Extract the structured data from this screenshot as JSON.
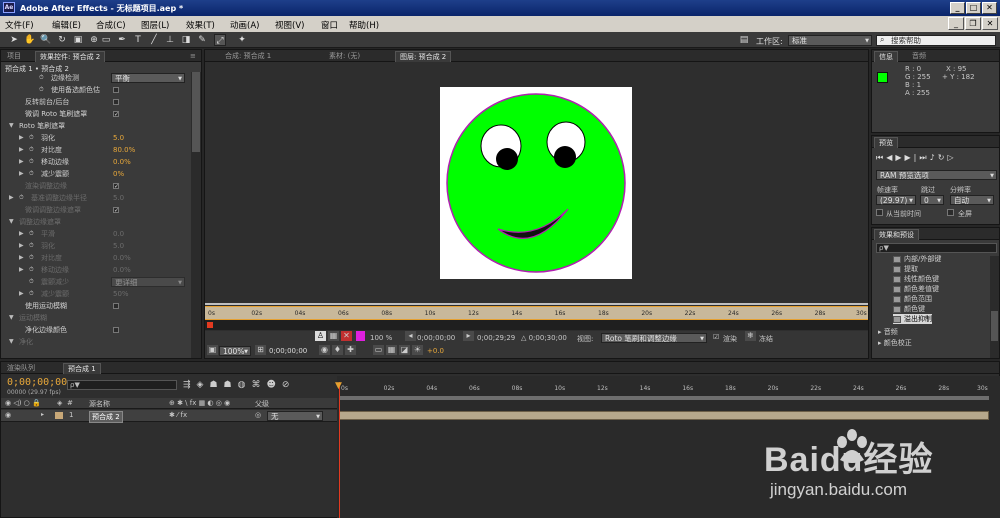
{
  "app": {
    "title": "Adobe After Effects - 无标题项目.aep *",
    "logo": "Ae"
  },
  "menu": [
    "文件(F)",
    "编辑(E)",
    "合成(C)",
    "图层(L)",
    "效果(T)",
    "动画(A)",
    "视图(V)",
    "窗口",
    "帮助(H)"
  ],
  "toolbar": {
    "workspace_label": "工作区:",
    "workspace_value": "标准",
    "search_placeholder": "搜索帮助"
  },
  "left_panel": {
    "tabs": [
      "项目",
      "效果控件: 预合成 2",
      "≡"
    ],
    "breadcrumb": "预合成 1 • 预合成 2",
    "rows": [
      {
        "label": "边缘检测",
        "value": "平衡",
        "type": "dropdown",
        "dim": false,
        "indent": 3
      },
      {
        "label": "使用备选颜色估",
        "value": "",
        "type": "check",
        "checked": false,
        "dim": false,
        "indent": 3
      },
      {
        "label": "反转前台/后台",
        "value": "",
        "type": "check",
        "checked": false,
        "dim": false,
        "indent": 1
      },
      {
        "label": "微调 Roto 笔刷遮罩",
        "value": "",
        "type": "check",
        "checked": true,
        "dim": false,
        "indent": 1
      },
      {
        "label": "Roto 笔刷遮罩",
        "value": "",
        "type": "group",
        "dim": false,
        "indent": 1
      },
      {
        "label": "羽化",
        "value": "5.0",
        "type": "num",
        "dim": false,
        "indent": 2
      },
      {
        "label": "对比度",
        "value": "80.0%",
        "type": "num",
        "dim": false,
        "indent": 2
      },
      {
        "label": "移动边缘",
        "value": "0.0%",
        "type": "num",
        "dim": false,
        "indent": 2
      },
      {
        "label": "减少震颤",
        "value": "0%",
        "type": "num",
        "dim": false,
        "indent": 2
      },
      {
        "label": "渲染调整边缘",
        "value": "",
        "type": "check",
        "checked": true,
        "dim": true,
        "indent": 1
      },
      {
        "label": "基准调整边缘半径",
        "value": "5.0",
        "type": "num",
        "dim": true,
        "indent": 1
      },
      {
        "label": "微调调整边缘遮罩",
        "value": "",
        "type": "check",
        "checked": true,
        "dim": true,
        "indent": 1
      },
      {
        "label": "调整边缘遮罩",
        "value": "",
        "type": "group",
        "dim": true,
        "indent": 1
      },
      {
        "label": "平滑",
        "value": "0.0",
        "type": "num",
        "dim": true,
        "indent": 2
      },
      {
        "label": "羽化",
        "value": "5.0",
        "type": "num",
        "dim": true,
        "indent": 2
      },
      {
        "label": "对比度",
        "value": "0.0%",
        "type": "num",
        "dim": true,
        "indent": 2
      },
      {
        "label": "移动边缘",
        "value": "0.0%",
        "type": "num",
        "dim": true,
        "indent": 2
      },
      {
        "label": "震颤减少",
        "value": "更详细",
        "type": "dropdown",
        "dim": true,
        "indent": 2
      },
      {
        "label": "减少震颤",
        "value": "50%",
        "type": "num",
        "dim": true,
        "indent": 2
      },
      {
        "label": "使用运动模糊",
        "value": "",
        "type": "check",
        "checked": false,
        "dim": false,
        "indent": 1
      },
      {
        "label": "运动模糊",
        "value": "",
        "type": "group",
        "dim": true,
        "indent": 1
      },
      {
        "label": "净化边缘颜色",
        "value": "",
        "type": "check",
        "checked": false,
        "dim": false,
        "indent": 1
      },
      {
        "label": "净化",
        "value": "",
        "type": "group",
        "dim": true,
        "indent": 1
      }
    ]
  },
  "viewer": {
    "tabs": [
      "合成: 预合成 1",
      "素材: (无)",
      "图层: 预合成 2"
    ],
    "ruler_labels": [
      "0s",
      "02s",
      "04s",
      "06s",
      "08s",
      "10s",
      "12s",
      "14s",
      "16s",
      "18s",
      "20s",
      "22s",
      "24s",
      "26s",
      "28s",
      "30s"
    ],
    "times": {
      "start": "0;00;00;00",
      "end": "0;00;29;29",
      "duration": "△ 0;00;30;00"
    },
    "view_label": "视图:",
    "view_value": "Roto 笔刷和调整边缘",
    "render_label": "渲染",
    "freeze_label": "冻结",
    "zoom": "100%",
    "zoom_pct": "100 %",
    "exposure": "+0.0",
    "current_time": "0;00;00;00",
    "colors": {
      "face": "#00ff00",
      "outline": "#b020b0",
      "bg": "#ffffff"
    }
  },
  "info_panel": {
    "tabs": [
      "信息",
      "音频"
    ],
    "r": "R : 0",
    "g": "G : 255",
    "b": "B : 1",
    "a": "A : 255",
    "x": "X : 95",
    "y": "+ Y : 182",
    "swatch": "#00ff00"
  },
  "preview_panel": {
    "tab": "预览",
    "ram_label": "RAM 预览选项",
    "frame_rate_label": "帧速率",
    "skip_label": "跳过",
    "resolution_label": "分辨率",
    "frame_rate": "(29.97)",
    "skip": "0",
    "resolution": "自动",
    "from_current": "从当前时间",
    "fullscreen": "全屏"
  },
  "effects_panel": {
    "tab": "效果和预设",
    "search_placeholder": "ρ▼",
    "items": [
      "内部/外部键",
      "提取",
      "线性颜色键",
      "颜色差值键",
      "颜色范围",
      "颜色键",
      "溢出抑制"
    ],
    "groups": [
      "音频",
      "颜色校正"
    ]
  },
  "timeline": {
    "tabs": [
      "渲染队列",
      "预合成 1"
    ],
    "current_time": "0;00;00;00",
    "fps": "00000 (29.97 fps)",
    "search_placeholder": "ρ▼",
    "col_source": "源名称",
    "col_parent": "父级",
    "layer_index": "1",
    "layer_name": "预合成 2",
    "parent_value": "无",
    "ruler_labels": [
      "0s",
      "02s",
      "04s",
      "06s",
      "08s",
      "10s",
      "12s",
      "14s",
      "16s",
      "18s",
      "20s",
      "22s",
      "24s",
      "26s",
      "28s",
      "30s"
    ]
  },
  "watermark": {
    "brand": "Baidu经验",
    "url": "jingyan.baidu.com"
  }
}
